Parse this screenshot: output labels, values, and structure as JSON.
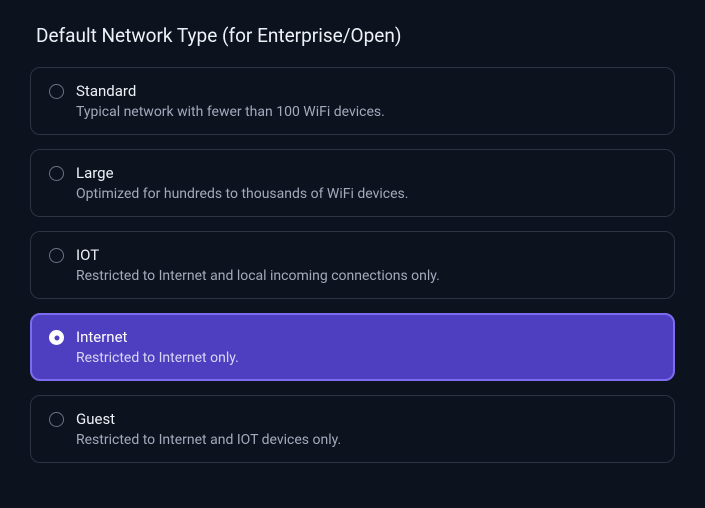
{
  "title": "Default Network Type (for Enterprise/Open)",
  "options": [
    {
      "label": "Standard",
      "desc": "Typical network with fewer than 100 WiFi devices.",
      "selected": false
    },
    {
      "label": "Large",
      "desc": "Optimized for hundreds to thousands of WiFi devices.",
      "selected": false
    },
    {
      "label": "IOT",
      "desc": "Restricted to Internet and local incoming connections only.",
      "selected": false
    },
    {
      "label": "Internet",
      "desc": "Restricted to Internet only.",
      "selected": true
    },
    {
      "label": "Guest",
      "desc": "Restricted to Internet and IOT devices only.",
      "selected": false
    }
  ]
}
